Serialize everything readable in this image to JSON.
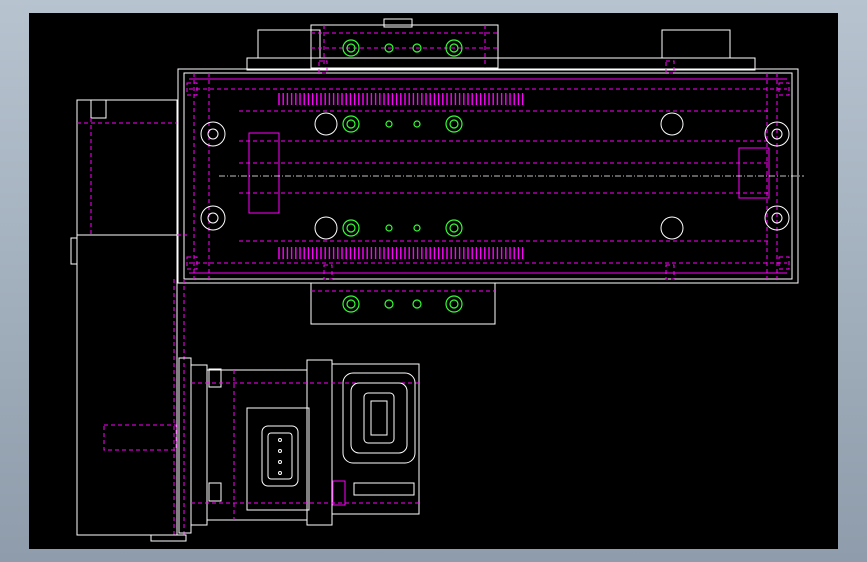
{
  "viewport": {
    "background": "#000000",
    "frame_color": "#9aa8b6"
  },
  "colors": {
    "outline": "#ffffff",
    "hidden": "#ff00ff",
    "holes": "#33ff33"
  },
  "icons": [
    "mounting-hole-icon",
    "connector-icon"
  ]
}
